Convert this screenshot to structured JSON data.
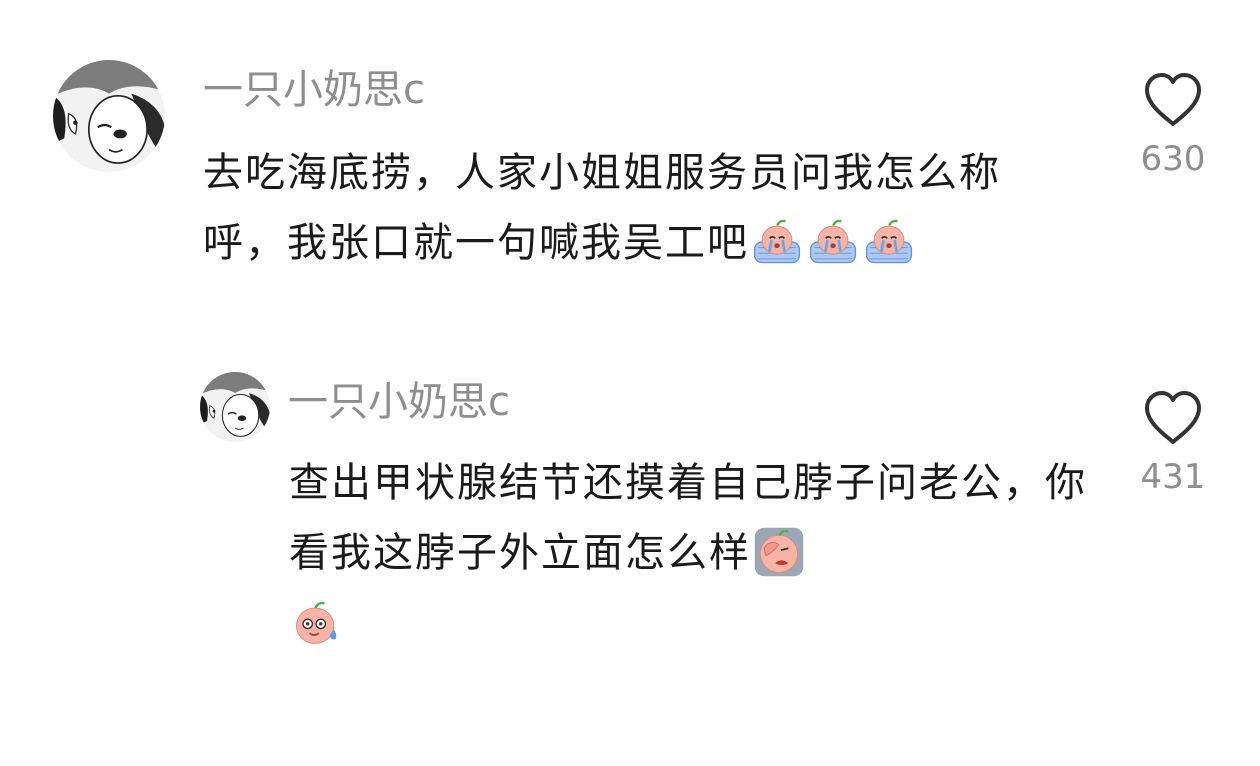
{
  "comments": [
    {
      "username": "一只小奶思c",
      "avatar": "girl-sketch-avatar",
      "text_parts": [
        "去吃海底捞，人家小姐姐服务员问我怎么称呼，我张口就一句喊我吴工吧"
      ],
      "emojis": [
        "crying-peach-emoji",
        "crying-peach-emoji",
        "crying-peach-emoji"
      ],
      "like_icon": "heart-outline-icon",
      "like_count": "630"
    },
    {
      "username": "一只小奶思c",
      "avatar": "girl-sketch-avatar",
      "text_parts": [
        "查出甲状腺结节还摸着自己脖子问老公，你看我这脖子外立面怎么样"
      ],
      "emojis": [
        "facepalm-peach-emoji",
        "sweating-peach-emoji"
      ],
      "like_icon": "heart-outline-icon",
      "like_count": "431"
    }
  ],
  "colors": {
    "username": "#8e8e8e",
    "text": "#1a1a1a",
    "like_count": "#8e8e8e",
    "heart_stroke": "#333333",
    "emoji_peach": "#f6b3a6",
    "emoji_tears": "#8fb8f0"
  }
}
